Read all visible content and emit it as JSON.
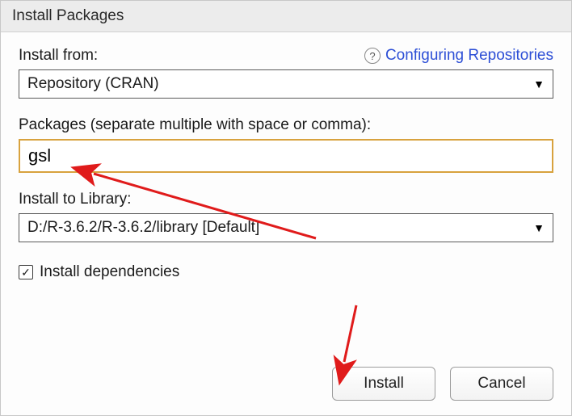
{
  "title": "Install Packages",
  "help_link": "Configuring Repositories",
  "install_from": {
    "label": "Install from:",
    "value": "Repository (CRAN)"
  },
  "packages": {
    "label": "Packages (separate multiple with space or comma):",
    "value": "gsl"
  },
  "library": {
    "label": "Install to Library:",
    "value": "D:/R-3.6.2/R-3.6.2/library [Default]"
  },
  "checkbox": {
    "label": "Install dependencies",
    "checked": true
  },
  "buttons": {
    "install": "Install",
    "cancel": "Cancel"
  },
  "icons": {
    "check": "✓",
    "help": "?",
    "dropdown": "▼"
  }
}
